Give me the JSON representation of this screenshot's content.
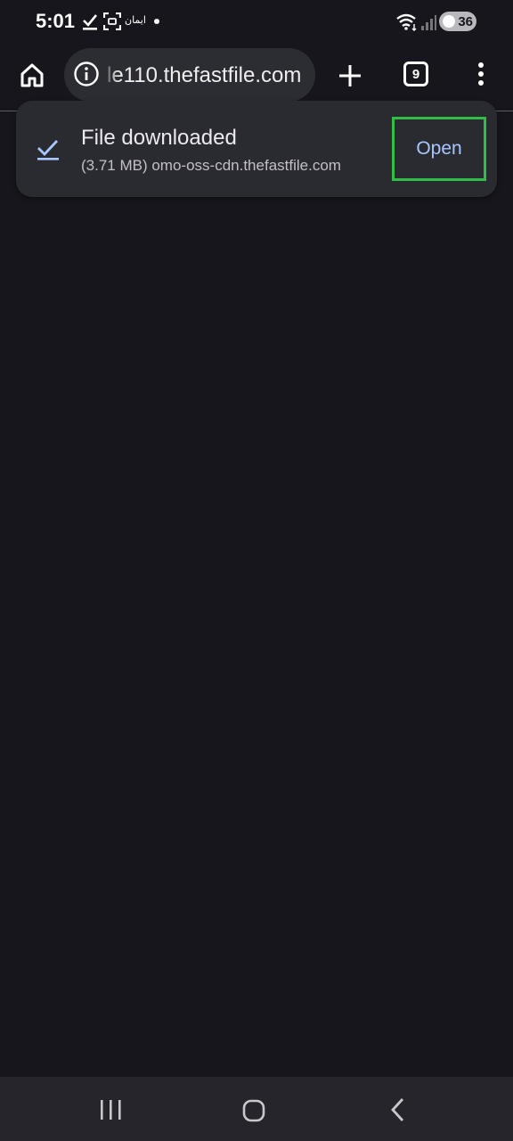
{
  "status_bar": {
    "time": "5:01",
    "arabic_label": "ايمان",
    "battery": "36",
    "icons": [
      "download-done-icon",
      "screenshot-icon",
      "wifi-icon",
      "signal-icon",
      "battery-icon"
    ]
  },
  "toolbar": {
    "url": "le110.thefastfile.com",
    "tab_count": "9",
    "icons": [
      "home-icon",
      "info-icon",
      "plus-icon",
      "tab-switcher-icon",
      "more-vert-icon"
    ]
  },
  "snackbar": {
    "title": "File downloaded",
    "subtitle": "(3.71 MB) omo-oss-cdn.thefastfile.com",
    "action_label": "Open",
    "check_icon": "download-check-icon",
    "highlight_color": "#2fbf49",
    "action_color": "#a9c7ff"
  },
  "nav_bar": {
    "icons": [
      "recents-icon",
      "home-circle-icon",
      "back-icon"
    ]
  }
}
